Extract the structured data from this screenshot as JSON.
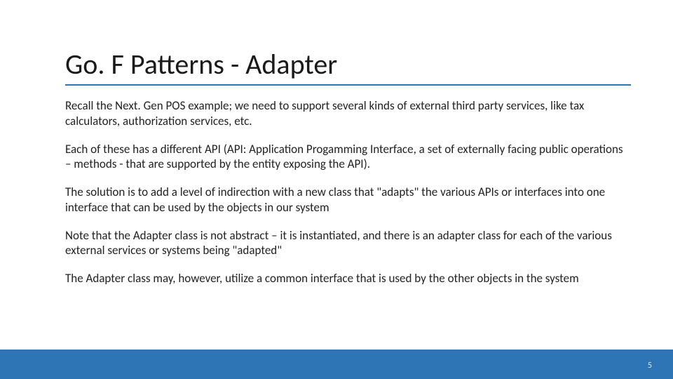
{
  "slide": {
    "title": "Go. F Patterns - Adapter",
    "paragraphs": [
      "Recall the Next. Gen POS example; we need to support several kinds of external third party services, like tax calculators, authorization services, etc.",
      "Each of these has a different API (API: Application Progamming Interface, a set of externally facing public operations – methods - that are supported by the entity exposing the API).",
      "The solution is to add a level of indirection with a new class that \"adapts\" the various APIs or interfaces into one interface that can be used by the objects in our system",
      "Note that the Adapter class is not abstract – it is instantiated, and there is an adapter class for each of the various external services or systems being \"adapted\"",
      "The Adapter class may, however, utilize a common interface that is used by the other objects in the system"
    ],
    "page_number": "5",
    "accent_color": "#2E75B6"
  }
}
